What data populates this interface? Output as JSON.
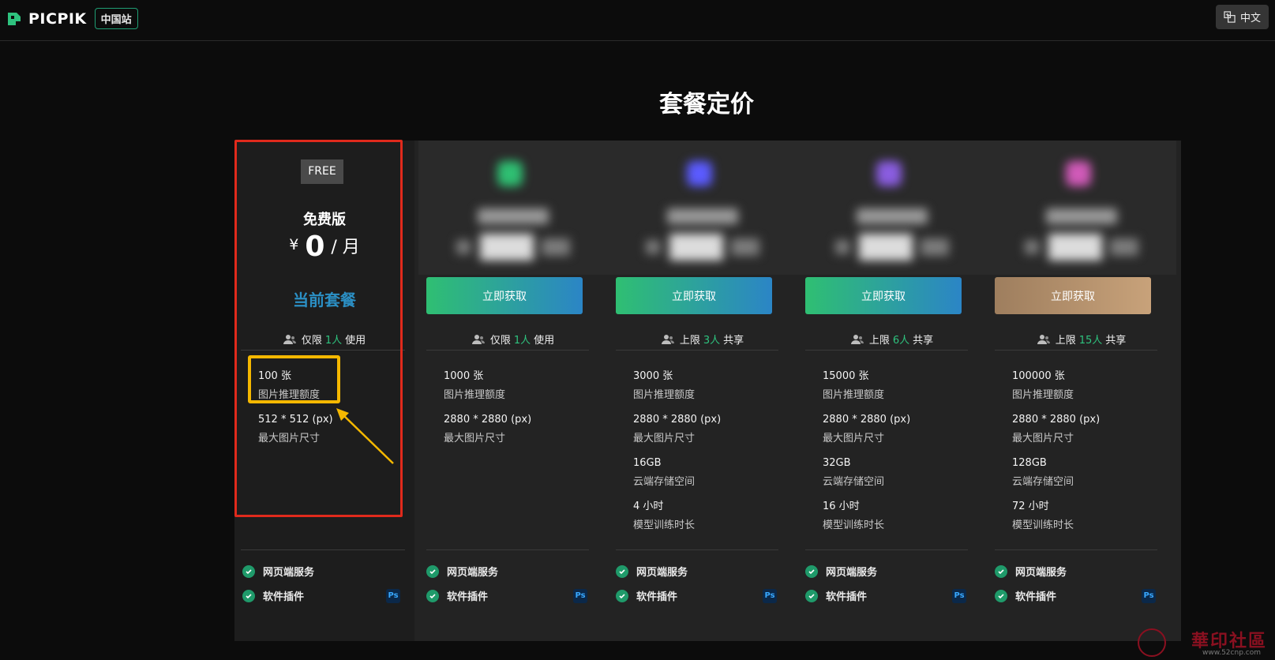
{
  "header": {
    "logo_text": "PICPIK",
    "site_badge": "中国站",
    "lang_label": "中文"
  },
  "page_title": "套餐定价",
  "plans": [
    {
      "tag": "FREE",
      "name": "免费版",
      "currency": "¥",
      "price": "0",
      "period": "/ 月",
      "status_label": "当前套餐",
      "seats": {
        "prefix": "仅限",
        "num": "1人",
        "suffix": "使用"
      },
      "features": [
        {
          "value": "100 张",
          "label": "图片推理额度"
        },
        {
          "value": "512 * 512 (px)",
          "label": "最大图片尺寸"
        }
      ]
    },
    {
      "tier_color": "#2fbf72",
      "button_label": "立即获取",
      "seats": {
        "prefix": "仅限",
        "num": "1人",
        "suffix": "使用"
      },
      "features": [
        {
          "value": "1000 张",
          "label": "图片推理额度"
        },
        {
          "value": "2880 * 2880 (px)",
          "label": "最大图片尺寸"
        }
      ]
    },
    {
      "tier_color": "#5b5bff",
      "button_label": "立即获取",
      "seats": {
        "prefix": "上限",
        "num": "3人",
        "suffix": "共享"
      },
      "features": [
        {
          "value": "3000 张",
          "label": "图片推理额度"
        },
        {
          "value": "2880 * 2880 (px)",
          "label": "最大图片尺寸"
        },
        {
          "value": "16GB",
          "label": "云端存储空间"
        },
        {
          "value": "4 小时",
          "label": "模型训练时长"
        }
      ]
    },
    {
      "tier_color": "#8a5de0",
      "button_label": "立即获取",
      "seats": {
        "prefix": "上限",
        "num": "6人",
        "suffix": "共享"
      },
      "features": [
        {
          "value": "15000 张",
          "label": "图片推理额度"
        },
        {
          "value": "2880 * 2880 (px)",
          "label": "最大图片尺寸"
        },
        {
          "value": "32GB",
          "label": "云端存储空间"
        },
        {
          "value": "16 小时",
          "label": "模型训练时长"
        }
      ]
    },
    {
      "tier_color": "#d05ab8",
      "button_label": "立即获取",
      "seats": {
        "prefix": "上限",
        "num": "15人",
        "suffix": "共享"
      },
      "features": [
        {
          "value": "100000 张",
          "label": "图片推理额度"
        },
        {
          "value": "2880 * 2880 (px)",
          "label": "最大图片尺寸"
        },
        {
          "value": "128GB",
          "label": "云端存储空间"
        },
        {
          "value": "72 小时",
          "label": "模型训练时长"
        }
      ]
    }
  ],
  "services": {
    "web": "网页端服务",
    "plugin": "软件插件",
    "plugin_badge": "Ps"
  },
  "watermark": {
    "text": "華印社區",
    "sub": "www.52cnp.com"
  }
}
